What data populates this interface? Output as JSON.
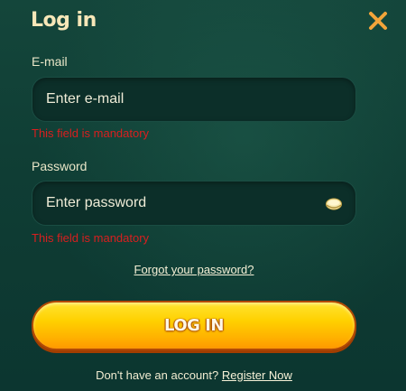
{
  "header": {
    "title": "Log in",
    "close_icon": "close-icon"
  },
  "email": {
    "label": "E-mail",
    "placeholder": "Enter e-mail",
    "value": "",
    "error": "This field is mandatory"
  },
  "password": {
    "label": "Password",
    "placeholder": "Enter password",
    "value": "",
    "error": "This field is mandatory",
    "toggle_icon": "eye-icon"
  },
  "links": {
    "forgot_password": "Forgot your password?"
  },
  "actions": {
    "login_label": "LOG IN"
  },
  "footer": {
    "prompt": "Don't have an account?",
    "register_label": "Register Now"
  },
  "colors": {
    "background": "#0f3d34",
    "title": "#f7e7b8",
    "close": "#f2a43a",
    "error": "#d91f1f",
    "button": "#ffc400"
  }
}
